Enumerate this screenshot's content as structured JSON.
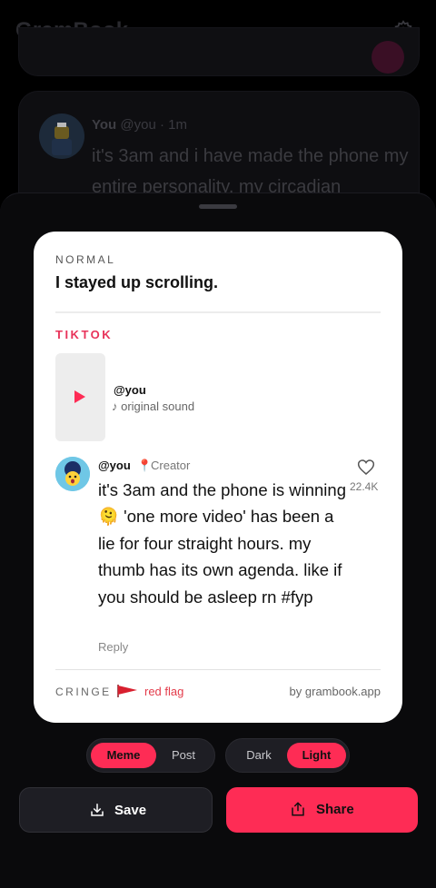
{
  "app": {
    "title": "GramBook"
  },
  "background_post": {
    "name": "You",
    "handle": "@you",
    "time": "· 1m",
    "text": "it's 3am and i have made the phone my entire personality. my circadian"
  },
  "card": {
    "normal_label": "NORMAL",
    "normal_text": "I stayed up scrolling.",
    "tiktok_label": "TIKTOK",
    "video": {
      "user": "@you",
      "sound": "♪ original sound"
    },
    "comment": {
      "user": "@you",
      "pin": "📍",
      "role": "Creator",
      "text": "it's 3am and the phone is winning 🫠 'one more video' has been a lie for four straight hours. my thumb has its own agenda. like if you should be asleep rn #fyp",
      "likes": "22.4K",
      "reply": "Reply"
    },
    "footer": {
      "cringe_label": "CRINGE",
      "flag_text": "red flag",
      "byline": "by grambook.app"
    }
  },
  "mode_toggle": {
    "options": [
      "Meme",
      "Post"
    ],
    "selected": "Meme"
  },
  "theme_toggle": {
    "options": [
      "Dark",
      "Light"
    ],
    "selected": "Light"
  },
  "actions": {
    "save": "Save",
    "share": "Share"
  },
  "colors": {
    "accent": "#fe2c55",
    "tiktok_red": "#e8335a",
    "flag_red": "#e33b4a"
  }
}
